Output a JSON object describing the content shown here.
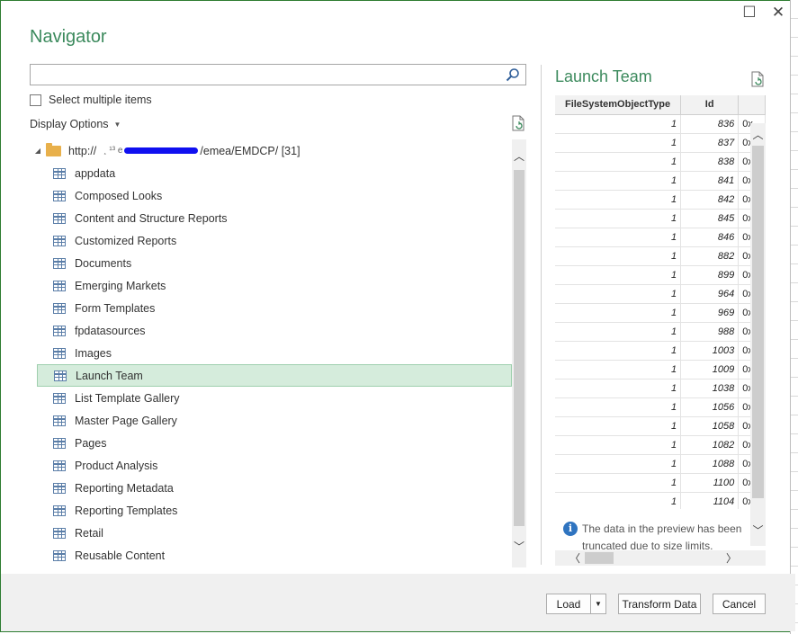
{
  "window": {
    "title": "Navigator",
    "maximize_glyph": "☐",
    "close_glyph": "✕"
  },
  "search": {
    "value": "",
    "placeholder": ""
  },
  "select_multiple": {
    "label": "Select multiple items",
    "checked": false
  },
  "display_options": {
    "label": "Display Options",
    "caret": "▼"
  },
  "tree": {
    "root": {
      "label_prefix": "http://",
      "label_mid": "¸ ¹³ e",
      "label_suffix": "/emea/EMDCP/ [31]",
      "expanded_glyph": "◢"
    },
    "items": [
      {
        "label": "appdata"
      },
      {
        "label": "Composed Looks"
      },
      {
        "label": "Content and Structure Reports"
      },
      {
        "label": "Customized Reports"
      },
      {
        "label": "Documents"
      },
      {
        "label": "Emerging Markets"
      },
      {
        "label": "Form Templates"
      },
      {
        "label": "fpdatasources"
      },
      {
        "label": "Images"
      },
      {
        "label": "Launch Team",
        "selected": true
      },
      {
        "label": "List Template Gallery"
      },
      {
        "label": "Master Page Gallery"
      },
      {
        "label": "Pages"
      },
      {
        "label": "Product Analysis"
      },
      {
        "label": "Reporting Metadata"
      },
      {
        "label": "Reporting Templates"
      },
      {
        "label": "Retail"
      },
      {
        "label": "Reusable Content"
      }
    ]
  },
  "preview": {
    "title": "Launch Team",
    "columns": [
      "FileSystemObjectType",
      "Id",
      ""
    ],
    "rows": [
      [
        "1",
        "836",
        "0x"
      ],
      [
        "1",
        "837",
        "0x"
      ],
      [
        "1",
        "838",
        "0x"
      ],
      [
        "1",
        "841",
        "0x"
      ],
      [
        "1",
        "842",
        "0x"
      ],
      [
        "1",
        "845",
        "0x"
      ],
      [
        "1",
        "846",
        "0x"
      ],
      [
        "1",
        "882",
        "0x"
      ],
      [
        "1",
        "899",
        "0x"
      ],
      [
        "1",
        "964",
        "0x"
      ],
      [
        "1",
        "969",
        "0x"
      ],
      [
        "1",
        "988",
        "0x"
      ],
      [
        "1",
        "1003",
        "0x"
      ],
      [
        "1",
        "1009",
        "0x"
      ],
      [
        "1",
        "1038",
        "0x"
      ],
      [
        "1",
        "1056",
        "0x"
      ],
      [
        "1",
        "1058",
        "0x"
      ],
      [
        "1",
        "1082",
        "0x"
      ],
      [
        "1",
        "1088",
        "0x"
      ],
      [
        "1",
        "1100",
        "0x"
      ],
      [
        "1",
        "1104",
        "0x"
      ]
    ],
    "note": "The data in the preview has been truncated due to size limits.",
    "info_glyph": "i"
  },
  "scroll_glyphs": {
    "up": "︿",
    "down": "﹀",
    "left": "〈",
    "right": "〉"
  },
  "footer": {
    "load_label": "Load",
    "load_arrow": "▼",
    "transform_label": "Transform Data",
    "cancel_label": "Cancel"
  }
}
